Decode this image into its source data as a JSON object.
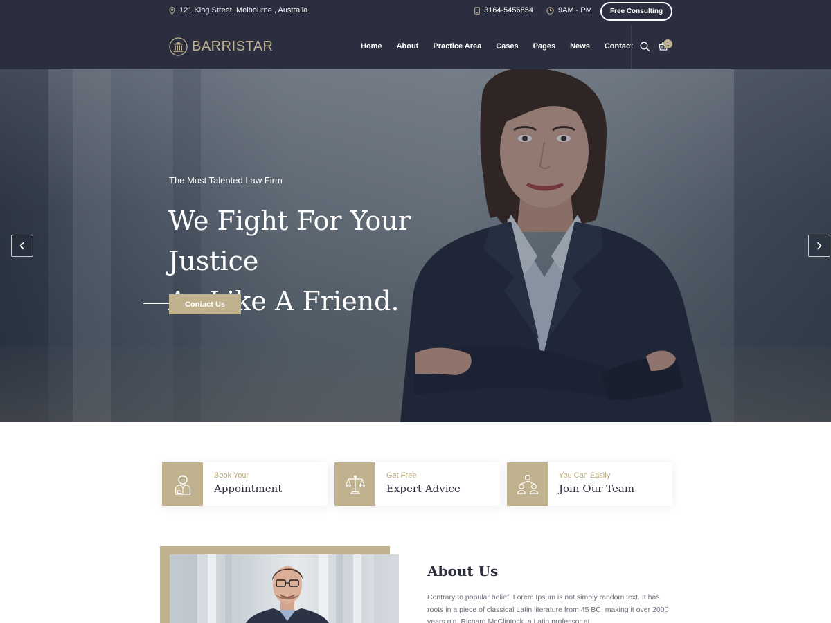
{
  "topbar": {
    "address": "121 King Street, Melbourne , Australia",
    "phone": "3164-5456854",
    "hours": "9AM - PM",
    "cta_label": "Free Consulting"
  },
  "nav": {
    "logo_text": "BARRISTAR",
    "items": [
      "Home",
      "About",
      "Practice Area",
      "Cases",
      "Pages",
      "News",
      "Contact"
    ],
    "cart_count": "1"
  },
  "hero": {
    "subtitle": "The Most Talented Law Firm",
    "title_line1": "We Fight For Your Justice",
    "title_line2": "As Like A Friend.",
    "button_label": "Contact Us"
  },
  "features": [
    {
      "kicker": "Book Your",
      "title": "Appointment",
      "icon": "lawyer-icon"
    },
    {
      "kicker": "Get Free",
      "title": "Expert Advice",
      "icon": "scales-icon"
    },
    {
      "kicker": "You Can Easily",
      "title": "Join Our Team",
      "icon": "team-icon"
    }
  ],
  "about": {
    "title": "About Us",
    "text": "Contrary to popular belief, Lorem Ipsum is not simply random text. It has roots in a piece of classical Latin literature from 45 BC, making it over 2000 years old. Richard McClintock, a Latin professor at"
  },
  "colors": {
    "navy": "#2a2e3f",
    "gold": "#c0b28e",
    "text_dark": "#2c2e3e",
    "text_muted": "#6b6e79"
  }
}
